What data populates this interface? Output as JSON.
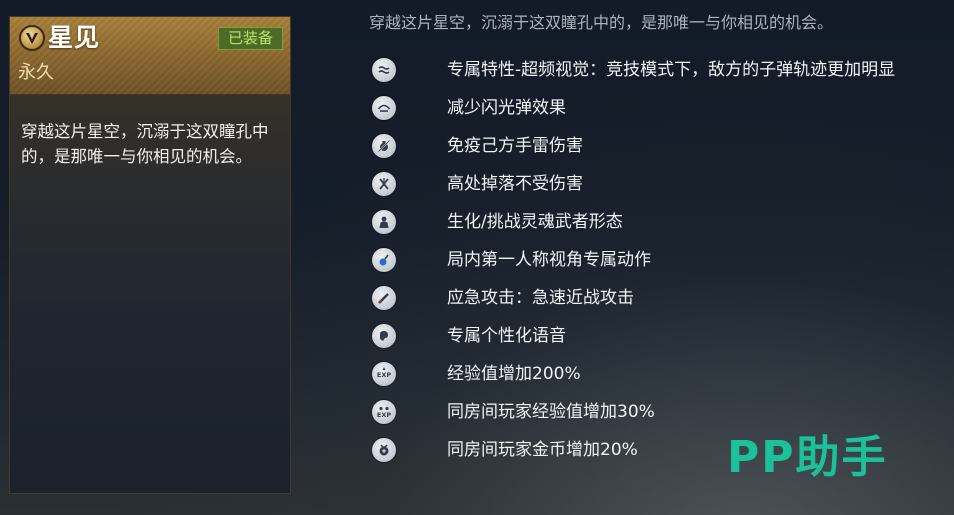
{
  "item": {
    "name": "星见",
    "badge_letter": "V",
    "equipped_label": "已装备",
    "duration": "永久",
    "description": "穿越这片星空，沉溺于这双瞳孔中的，是那唯一与你相见的机会。"
  },
  "header_description": "穿越这片星空，沉溺于这双瞳孔中的，是那唯一与你相见的机会。",
  "perks": [
    {
      "icon": "wave-eye-icon",
      "label": "专属特性-超频视觉：竞技模式下，敌方的子弹轨迹更加明显"
    },
    {
      "icon": "flash-reduce-icon",
      "label": "减少闪光弹效果"
    },
    {
      "icon": "grenade-immune-icon",
      "label": "免疫己方手雷伤害"
    },
    {
      "icon": "fall-damage-icon",
      "label": "高处掉落不受伤害"
    },
    {
      "icon": "ghost-form-icon",
      "label": "生化/挑战灵魂武者形态"
    },
    {
      "icon": "first-person-icon",
      "label": "局内第一人称视角专属动作"
    },
    {
      "icon": "melee-icon",
      "label": "应急攻击：急速近战攻击"
    },
    {
      "icon": "voice-icon",
      "label": "专属个性化语音"
    },
    {
      "icon": "exp-icon",
      "label": "经验值增加200%"
    },
    {
      "icon": "room-exp-icon",
      "label": "同房间玩家经验值增加30%"
    },
    {
      "icon": "coin-icon",
      "label": "同房间玩家金币增加20%"
    }
  ],
  "watermark": "PP助手",
  "colors": {
    "card_gold": "#a8803a",
    "equipped_green": "#b8e36a",
    "watermark_teal": "#1bc198"
  }
}
